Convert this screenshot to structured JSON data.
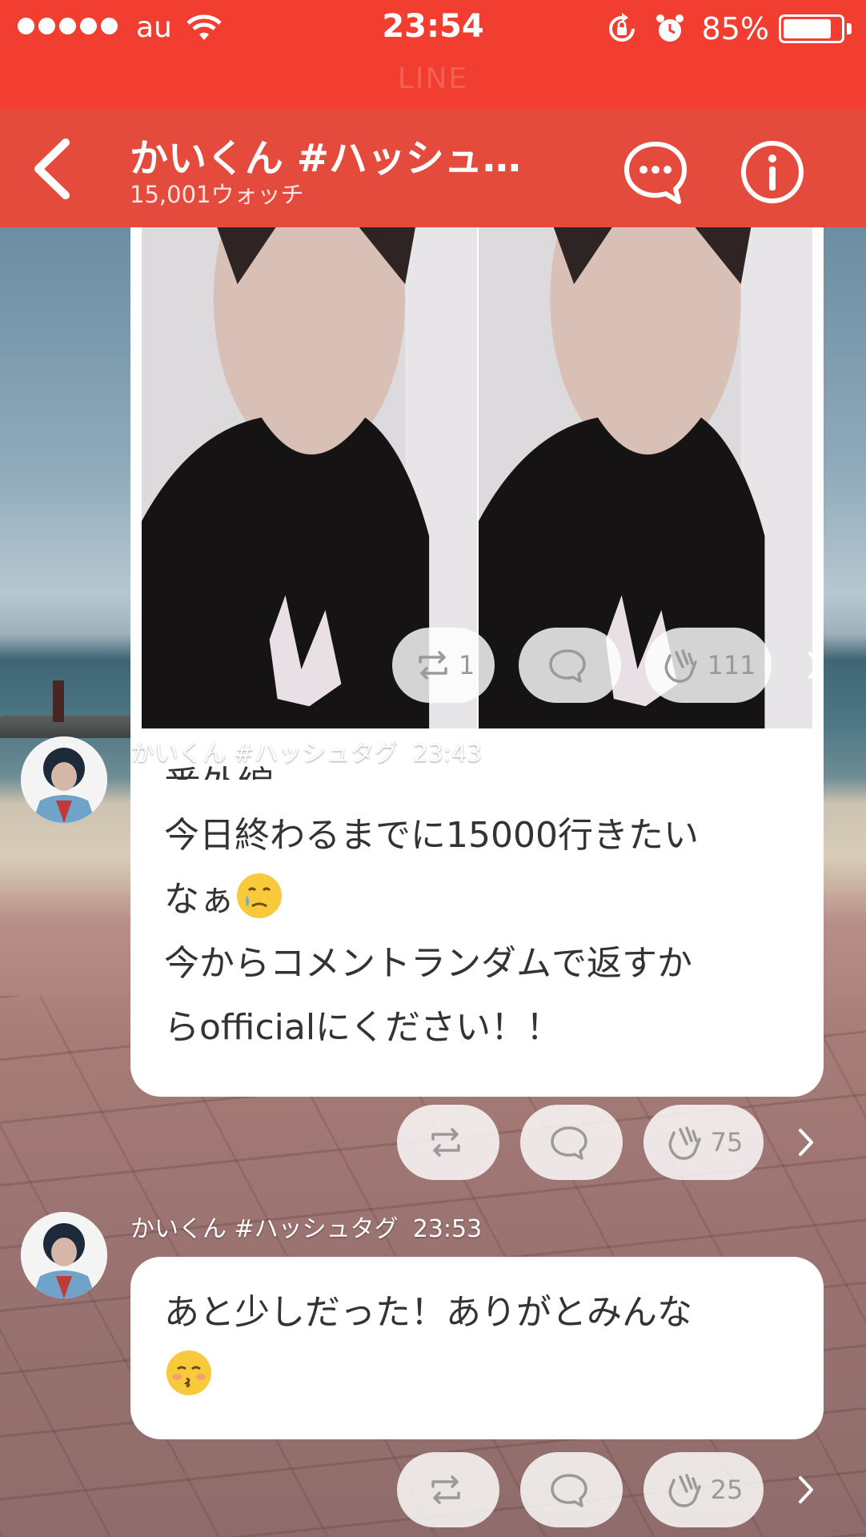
{
  "status_bar": {
    "carrier": "au",
    "time": "23:54",
    "battery": "85%",
    "battery_level": 0.85,
    "app_name": "LINE"
  },
  "header": {
    "title": "かいくん #ハッシュ…",
    "subtitle": "15,001ウォッチ"
  },
  "posts": [
    {
      "type": "image-card",
      "caption": "番外編",
      "actions": {
        "share_count": "1",
        "comment_count": "",
        "clap_count": "111"
      }
    },
    {
      "type": "text",
      "author": "かいくん #ハッシュタグ",
      "time": "23:43",
      "line1": "今日終わるまでに15000行きたい",
      "line2": "なぁ",
      "line3": "今からコメントランダムで返すか",
      "line4": "らofficialにください！！",
      "actions": {
        "share_count": "",
        "comment_count": "",
        "clap_count": "75"
      }
    },
    {
      "type": "text",
      "author": "かいくん #ハッシュタグ",
      "time": "23:53",
      "line1": "あと少しだった！ありがとみんな",
      "actions": {
        "share_count": "",
        "comment_count": "",
        "clap_count": "25"
      }
    }
  ],
  "icons": {
    "back": "chevron-left-icon",
    "chat": "chat-bubble-icon",
    "info": "info-icon",
    "share": "repost-icon",
    "comment": "comment-icon",
    "clap": "clap-icon",
    "more": "chevron-right-icon"
  },
  "colors": {
    "status_bar": "#f13e30",
    "header": "#e54b3d",
    "bubble": "#ffffff"
  }
}
